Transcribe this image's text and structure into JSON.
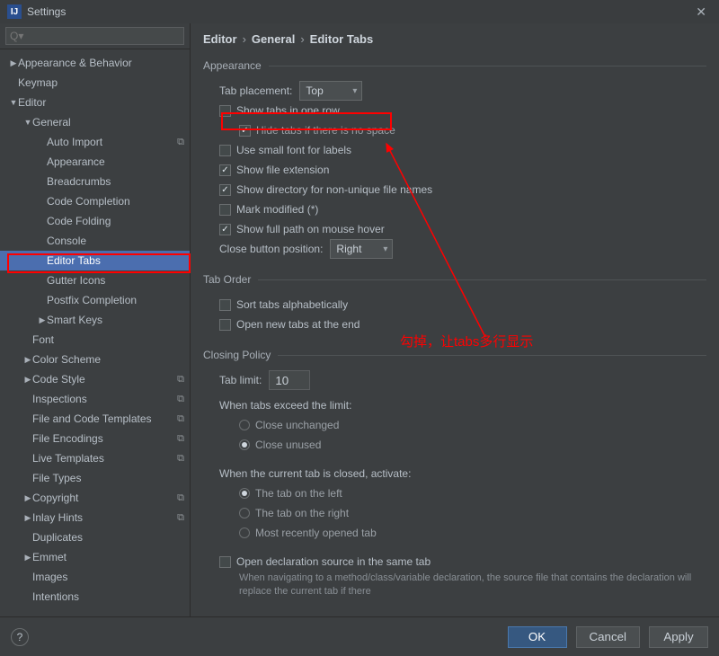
{
  "window": {
    "title": "Settings"
  },
  "search": {
    "placeholder": "Q▾"
  },
  "tree": {
    "items": [
      {
        "label": "Appearance & Behavior",
        "indent": 0,
        "arrow": "▶"
      },
      {
        "label": "Keymap",
        "indent": 0,
        "arrow": ""
      },
      {
        "label": "Editor",
        "indent": 0,
        "arrow": "▼"
      },
      {
        "label": "General",
        "indent": 1,
        "arrow": "▼"
      },
      {
        "label": "Auto Import",
        "indent": 2,
        "arrow": "",
        "override": true
      },
      {
        "label": "Appearance",
        "indent": 2,
        "arrow": ""
      },
      {
        "label": "Breadcrumbs",
        "indent": 2,
        "arrow": ""
      },
      {
        "label": "Code Completion",
        "indent": 2,
        "arrow": ""
      },
      {
        "label": "Code Folding",
        "indent": 2,
        "arrow": ""
      },
      {
        "label": "Console",
        "indent": 2,
        "arrow": ""
      },
      {
        "label": "Editor Tabs",
        "indent": 2,
        "arrow": "",
        "selected": true
      },
      {
        "label": "Gutter Icons",
        "indent": 2,
        "arrow": ""
      },
      {
        "label": "Postfix Completion",
        "indent": 2,
        "arrow": ""
      },
      {
        "label": "Smart Keys",
        "indent": 2,
        "arrow": "▶"
      },
      {
        "label": "Font",
        "indent": 1,
        "arrow": ""
      },
      {
        "label": "Color Scheme",
        "indent": 1,
        "arrow": "▶"
      },
      {
        "label": "Code Style",
        "indent": 1,
        "arrow": "▶",
        "override": true
      },
      {
        "label": "Inspections",
        "indent": 1,
        "arrow": "",
        "override": true
      },
      {
        "label": "File and Code Templates",
        "indent": 1,
        "arrow": "",
        "override": true
      },
      {
        "label": "File Encodings",
        "indent": 1,
        "arrow": "",
        "override": true
      },
      {
        "label": "Live Templates",
        "indent": 1,
        "arrow": "",
        "override": true
      },
      {
        "label": "File Types",
        "indent": 1,
        "arrow": ""
      },
      {
        "label": "Copyright",
        "indent": 1,
        "arrow": "▶",
        "override": true
      },
      {
        "label": "Inlay Hints",
        "indent": 1,
        "arrow": "▶",
        "override": true
      },
      {
        "label": "Duplicates",
        "indent": 1,
        "arrow": ""
      },
      {
        "label": "Emmet",
        "indent": 1,
        "arrow": "▶"
      },
      {
        "label": "Images",
        "indent": 1,
        "arrow": ""
      },
      {
        "label": "Intentions",
        "indent": 1,
        "arrow": ""
      }
    ]
  },
  "breadcrumb": {
    "a": "Editor",
    "b": "General",
    "c": "Editor Tabs"
  },
  "sections": {
    "appearance": {
      "title": "Appearance",
      "tab_placement_label": "Tab placement:",
      "tab_placement_value": "Top",
      "show_one_row": "Show tabs in one row",
      "hide_no_space": "Hide tabs if there is no space",
      "small_font": "Use small font for labels",
      "show_ext": "Show file extension",
      "show_dir": "Show directory for non-unique file names",
      "mark_modified": "Mark modified (*)",
      "show_full_path": "Show full path on mouse hover",
      "close_button_label": "Close button position:",
      "close_button_value": "Right"
    },
    "tab_order": {
      "title": "Tab Order",
      "sort_alpha": "Sort tabs alphabetically",
      "open_end": "Open new tabs at the end"
    },
    "closing": {
      "title": "Closing Policy",
      "tab_limit_label": "Tab limit:",
      "tab_limit_value": "10",
      "exceed_label": "When tabs exceed the limit:",
      "close_unchanged": "Close unchanged",
      "close_unused": "Close unused",
      "activate_label": "When the current tab is closed, activate:",
      "tab_left": "The tab on the left",
      "tab_right": "The tab on the right",
      "tab_recent": "Most recently opened tab",
      "open_decl": "Open declaration source in the same tab",
      "open_decl_hint": "When navigating to a method/class/variable declaration, the source file that contains the declaration will replace the current tab if there"
    }
  },
  "annotation": {
    "text": "勾掉，让tabs多行显示"
  },
  "buttons": {
    "ok": "OK",
    "cancel": "Cancel",
    "apply": "Apply",
    "help": "?"
  }
}
